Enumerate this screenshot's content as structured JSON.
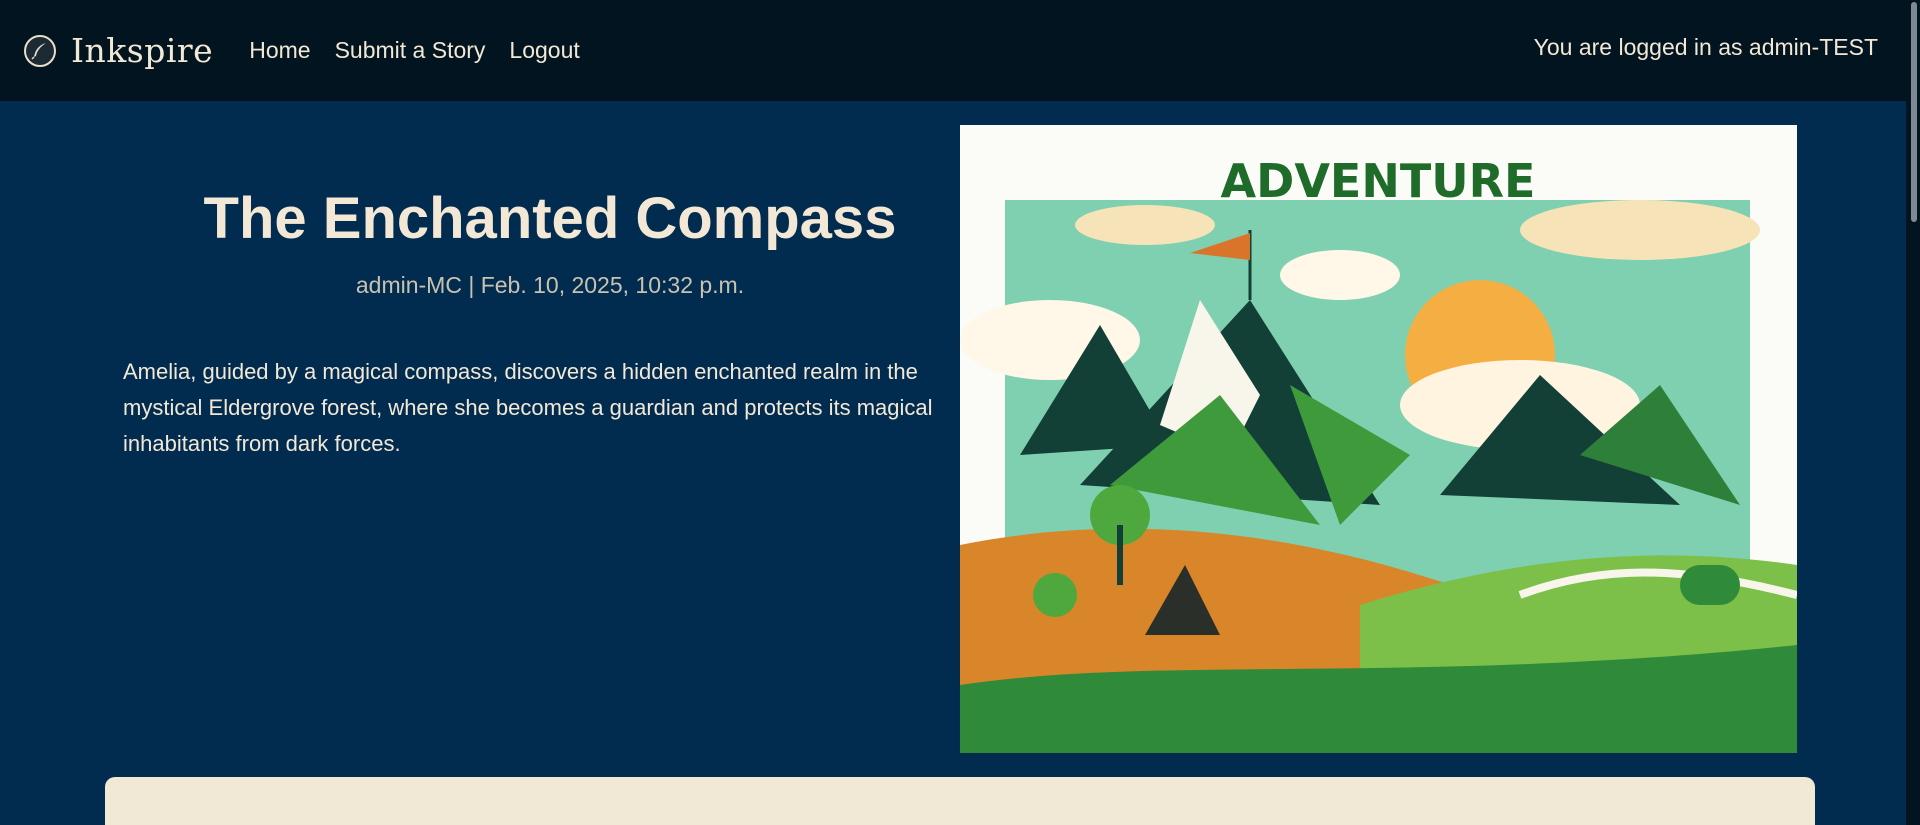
{
  "brand": {
    "name": "Inkspire",
    "logo_icon": "feather-quill-icon"
  },
  "nav": {
    "items": [
      {
        "label": "Home"
      },
      {
        "label": "Submit a Story"
      },
      {
        "label": "Logout"
      }
    ]
  },
  "user": {
    "status": "You are logged in as admin-TEST"
  },
  "story": {
    "title": "The Enchanted Compass",
    "meta": "admin-MC | Feb. 10, 2025, 10:32 p.m.",
    "summary": "Amelia, guided by a magical compass, discovers a hidden enchanted realm in the mystical Eldergrove forest, where she becomes a guardian and protects its magical inhabitants from dark forces.",
    "cover": {
      "heading": "ADVENTURE"
    }
  },
  "colors": {
    "navbar_bg": "#02141f",
    "page_bg": "#022c4f",
    "text": "#f2e8d5",
    "card_bg": "#f1e9d6",
    "cover_green": "#1f6b2a",
    "cover_teal": "#7fd0b0",
    "cover_orange": "#d9862a"
  }
}
